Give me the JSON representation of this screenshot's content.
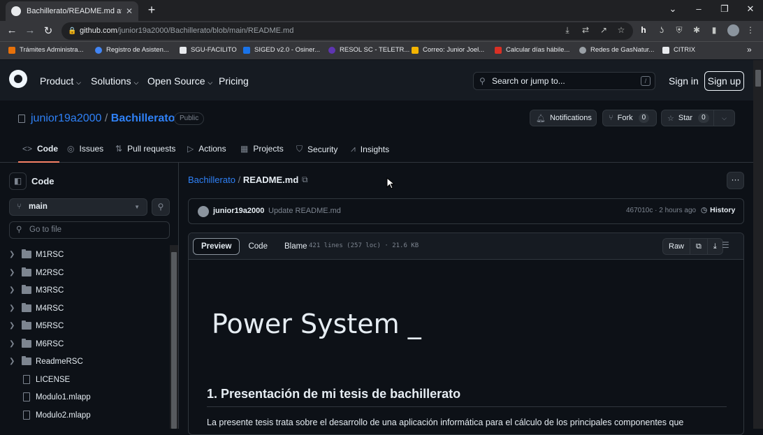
{
  "browser": {
    "tab_title": "Bachillerato/README.md at main",
    "tab_close": "✕",
    "new_tab": "+",
    "url_host": "github.com",
    "url_path": "/junior19a2000/Bachillerato/blob/main/README.md",
    "bookmarks": [
      {
        "label": "Trámites Administra...",
        "color": "#e8710a"
      },
      {
        "label": "Registro de Asisten...",
        "color": "#4285f4"
      },
      {
        "label": "SGU-FACILITO",
        "color": "#e8eaed"
      },
      {
        "label": "SIGED v2.0 - Osiner...",
        "color": "#1a73e8"
      },
      {
        "label": "RESOL SC - TELETR...",
        "color": "#5e35b1"
      },
      {
        "label": "Correo: Junior Joel...",
        "color": "#f4b400"
      },
      {
        "label": "Calcular días hábile...",
        "color": "#d93025"
      },
      {
        "label": "Redes de GasNatur...",
        "color": "#9aa0a6"
      },
      {
        "label": "CITRIX",
        "color": "#e8eaed"
      }
    ],
    "bookmarks_more": "»"
  },
  "github": {
    "nav": [
      "Product",
      "Solutions",
      "Open Source",
      "Pricing"
    ],
    "search_placeholder": "Search or jump to...",
    "search_key": "/",
    "sign_in": "Sign in",
    "sign_up": "Sign up"
  },
  "repo": {
    "owner": "junior19a2000",
    "sep": "/",
    "name": "Bachillerato",
    "visibility": "Public",
    "notifications": "Notifications",
    "fork": "Fork",
    "fork_count": "0",
    "star": "Star",
    "star_count": "0",
    "tabs": [
      "Code",
      "Issues",
      "Pull requests",
      "Actions",
      "Projects",
      "Security",
      "Insights"
    ]
  },
  "sidebar": {
    "title": "Code",
    "branch": "main",
    "go_to_file": "Go to file",
    "items": [
      {
        "name": "M1RSC",
        "type": "folder"
      },
      {
        "name": "M2RSC",
        "type": "folder"
      },
      {
        "name": "M3RSC",
        "type": "folder"
      },
      {
        "name": "M4RSC",
        "type": "folder"
      },
      {
        "name": "M5RSC",
        "type": "folder"
      },
      {
        "name": "M6RSC",
        "type": "folder"
      },
      {
        "name": "ReadmeRSC",
        "type": "folder"
      },
      {
        "name": "LICENSE",
        "type": "file"
      },
      {
        "name": "Modulo1.mlapp",
        "type": "file"
      },
      {
        "name": "Modulo2.mlapp",
        "type": "file"
      }
    ]
  },
  "file": {
    "repo_link": "Bachillerato",
    "sep": "/",
    "filename": "README.md",
    "commit_author": "junior19a2000",
    "commit_message": "Update README.md",
    "commit_hash_time": "467010c · 2 hours ago",
    "history": "History",
    "tabs": [
      "Preview",
      "Code",
      "Blame"
    ],
    "meta": "421 lines (257 loc) · 21.6 KB",
    "raw": "Raw",
    "heading1": "Power System _",
    "heading2": "1. Presentación de mi tesis de bachillerato",
    "paragraph": "La presente tesis trata sobre el desarrollo de una aplicación informática para el cálculo de los principales componentes que"
  }
}
